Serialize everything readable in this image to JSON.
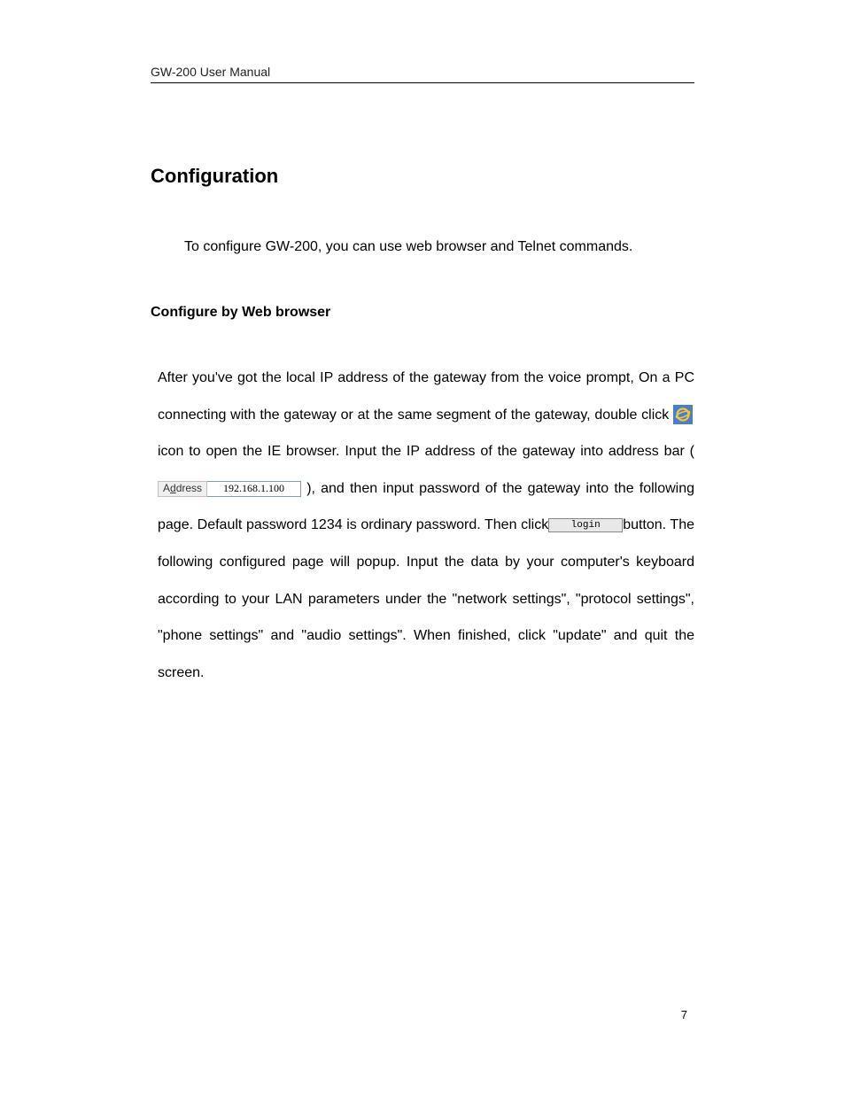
{
  "header": {
    "title": "GW-200 User Manual"
  },
  "section": {
    "title": "Configuration",
    "intro": "To configure GW-200, you can use web browser and Telnet commands."
  },
  "subsection": {
    "title": "Configure by Web browser"
  },
  "body": {
    "part1": "After you've got the local IP address of the gateway from the voice prompt, On a PC connecting with the gateway or at the same segment of the gateway, double click ",
    "part2": " icon to open the IE browser. Input the IP address of the gateway into address bar ( ",
    "part3": " ), and then input password of the gateway into the following page. Default password 1234 is ordinary password. Then click",
    "part4": "button. The following configured page will popup. Input the data by your computer's keyboard according to your LAN parameters under the \"network settings\", \"protocol settings\", \"phone settings\" and \"audio settings\". When finished, click \"update\" and quit the screen."
  },
  "address_bar": {
    "label_prefix": "A",
    "label_underline": "d",
    "label_suffix": "dress",
    "value": "192.168.1.100"
  },
  "login_button": {
    "label": "login"
  },
  "page_number": "7"
}
